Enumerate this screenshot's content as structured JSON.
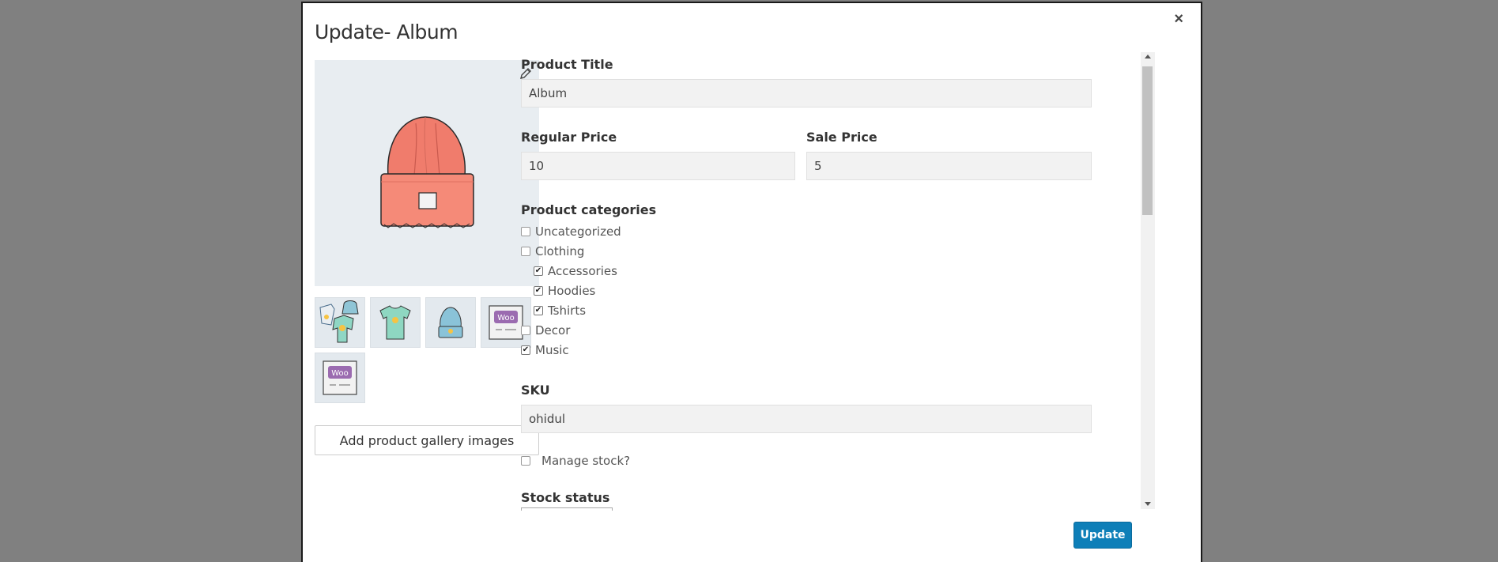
{
  "modal": {
    "title": "Update- Album",
    "close_label": "×"
  },
  "media": {
    "gallery_button": "Add product gallery images",
    "thumbnails": [
      "hoodie-set",
      "tshirt",
      "beanie",
      "woo-poster",
      "woo-poster"
    ]
  },
  "form": {
    "title_label": "Product Title",
    "title_value": "Album",
    "regular_price_label": "Regular Price",
    "regular_price_value": "10",
    "sale_price_label": "Sale Price",
    "sale_price_value": "5",
    "categories_label": "Product categories",
    "categories": [
      {
        "label": "Uncategorized",
        "checked": false,
        "level": 0
      },
      {
        "label": "Clothing",
        "checked": false,
        "level": 0
      },
      {
        "label": "Accessories",
        "checked": true,
        "level": 1
      },
      {
        "label": "Hoodies",
        "checked": true,
        "level": 1
      },
      {
        "label": "Tshirts",
        "checked": true,
        "level": 1
      },
      {
        "label": "Decor",
        "checked": false,
        "level": 0
      },
      {
        "label": "Music",
        "checked": true,
        "level": 0
      }
    ],
    "sku_label": "SKU",
    "sku_value": "ohidul",
    "manage_stock_label": "Manage stock?",
    "manage_stock_checked": false,
    "stock_status_label": "Stock status"
  },
  "footer": {
    "update_button": "Update"
  },
  "colors": {
    "backdrop": "#808080",
    "primary": "#0e7fb8",
    "image_bg": "#e8edf1",
    "input_bg": "#f2f2f2"
  }
}
